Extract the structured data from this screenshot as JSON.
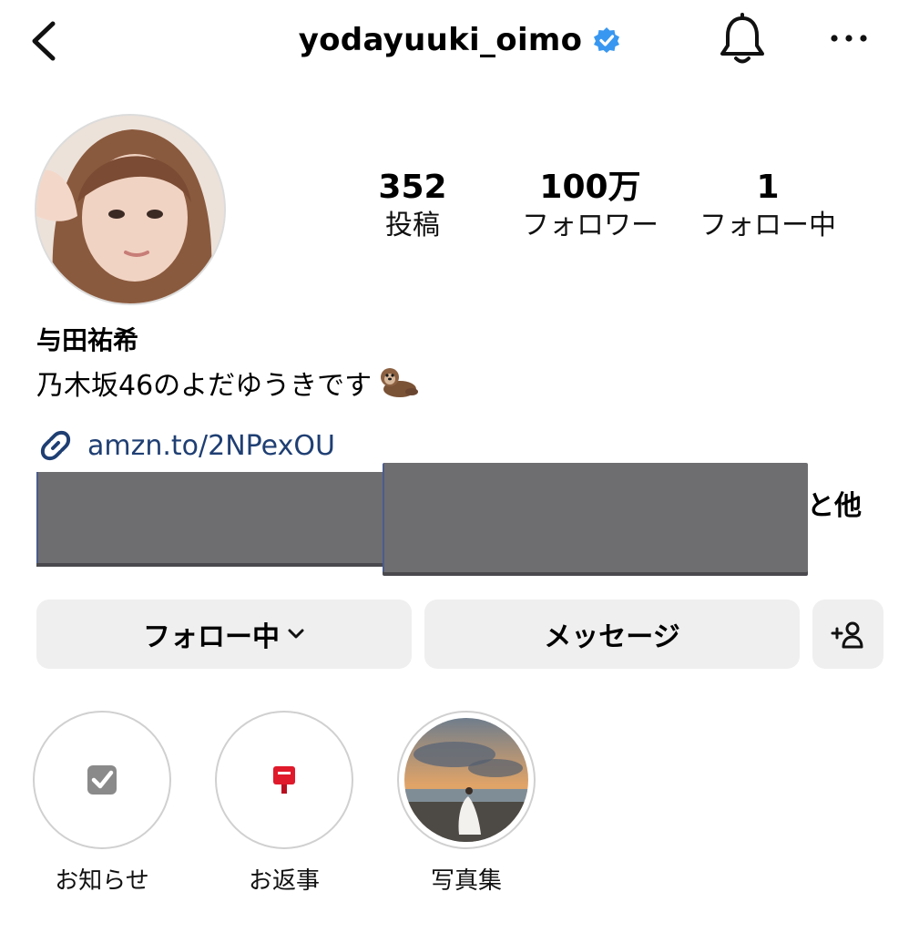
{
  "header": {
    "username": "yodayuuki_oimo"
  },
  "stats": [
    {
      "value": "352",
      "label": "投稿"
    },
    {
      "value": "100万",
      "label": "フォロワー"
    },
    {
      "value": "1",
      "label": "フォロー中"
    }
  ],
  "profile": {
    "name": "与田祐希",
    "bio": "乃木坂46のよだゆうきです",
    "link": "amzn.to/2NPexOU",
    "followed_by_suffix": "と他"
  },
  "actions": {
    "follow_label": "フォロー中",
    "message_label": "メッセージ"
  },
  "highlights": [
    {
      "label": "お知らせ",
      "icon": "checkbox-icon"
    },
    {
      "label": "お返事",
      "icon": "postbox-icon"
    },
    {
      "label": "写真集",
      "icon": "photo-thumbnail"
    }
  ],
  "colors": {
    "verified": "#3897f0",
    "link": "#1f3f73",
    "button_bg": "#efefef"
  }
}
